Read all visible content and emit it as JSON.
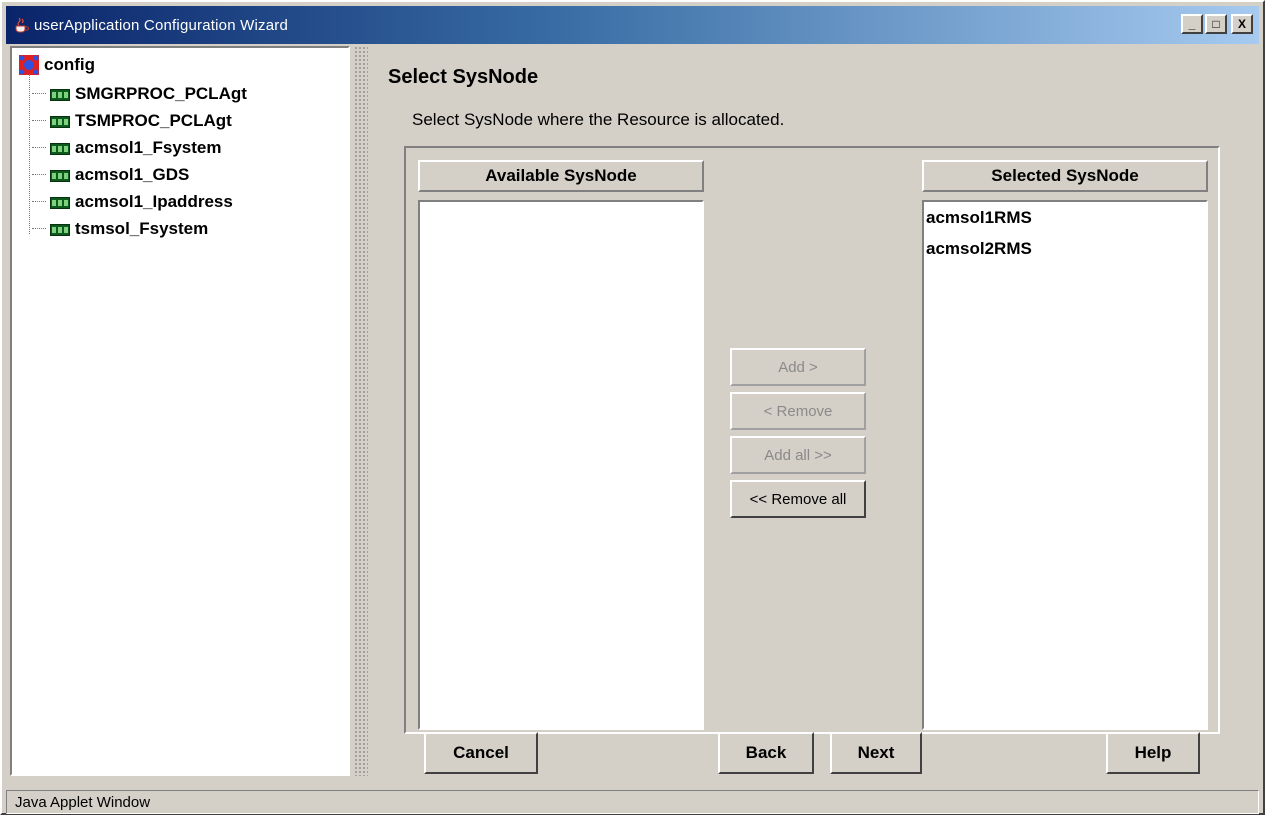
{
  "window": {
    "title": "userApplication Configuration Wizard",
    "controls": [
      "_",
      "□",
      "X"
    ]
  },
  "tree": {
    "root": {
      "label": "config",
      "icon": "config-root-icon"
    },
    "items": [
      {
        "label": "SMGRPROC_PCLAgt",
        "icon": "resource-icon"
      },
      {
        "label": "TSMPROC_PCLAgt",
        "icon": "resource-icon"
      },
      {
        "label": "acmsol1_Fsystem",
        "icon": "resource-icon"
      },
      {
        "label": "acmsol1_GDS",
        "icon": "resource-icon"
      },
      {
        "label": "acmsol1_Ipaddress",
        "icon": "resource-icon"
      },
      {
        "label": "tsmsol_Fsystem",
        "icon": "resource-icon"
      }
    ]
  },
  "main": {
    "heading": "Select SysNode",
    "instruction": "Select SysNode where the Resource is allocated.",
    "available": {
      "header": "Available SysNode",
      "items": []
    },
    "selected": {
      "header": "Selected SysNode",
      "items": [
        "acmsol1RMS",
        "acmsol2RMS"
      ]
    },
    "buttons": {
      "add": "Add >",
      "remove": "< Remove",
      "add_all": "Add all >>",
      "remove_all": "<< Remove all"
    },
    "footer": {
      "cancel": "Cancel",
      "back": "Back",
      "next": "Next",
      "help": "Help"
    }
  },
  "status": {
    "text": "Java Applet Window"
  },
  "colors": {
    "title_gradient_start": "#0a246a",
    "title_gradient_end": "#a6caf0",
    "panel_bg": "#d4d0c8"
  }
}
